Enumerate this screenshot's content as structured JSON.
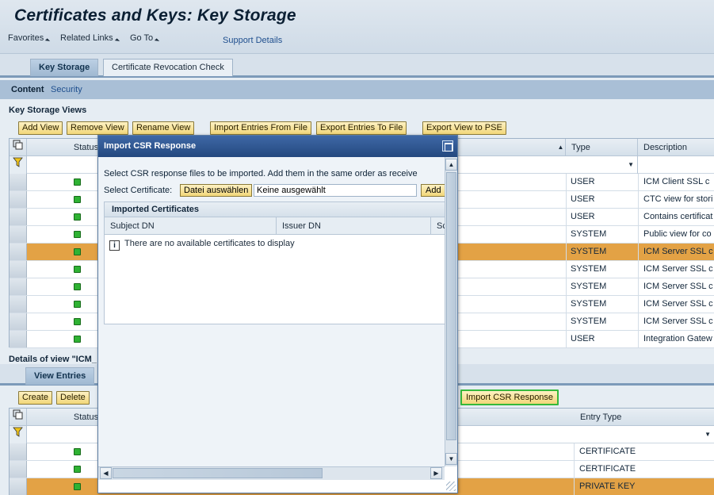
{
  "page": {
    "title": "Certificates and Keys: Key Storage",
    "menu": [
      "Favorites",
      "Related Links",
      "Go To"
    ],
    "support_link": "Support Details"
  },
  "tabs": [
    {
      "label": "Key Storage",
      "active": true
    },
    {
      "label": "Certificate Revocation Check",
      "active": false
    }
  ],
  "subnav": {
    "content": "Content",
    "security": "Security"
  },
  "key_storage_views": {
    "title": "Key Storage Views",
    "toolbar": [
      "Add View",
      "Remove View",
      "Rename View",
      "Import Entries From File",
      "Export Entries To File",
      "Export View to PSE"
    ],
    "columns": {
      "status": "Status",
      "type": "Type",
      "description": "Description"
    },
    "rows": [
      {
        "type": "USER",
        "description": "ICM Client SSL c",
        "selected": false
      },
      {
        "type": "USER",
        "description": "CTC view for stori",
        "selected": false
      },
      {
        "type": "USER",
        "description": "Contains certificat",
        "selected": false
      },
      {
        "type": "SYSTEM",
        "description": "Public view for co",
        "selected": false
      },
      {
        "type": "SYSTEM",
        "description": "ICM Server SSL c",
        "selected": true
      },
      {
        "type": "SYSTEM",
        "description": "ICM Server SSL c",
        "selected": false
      },
      {
        "type": "SYSTEM",
        "description": "ICM Server SSL c",
        "selected": false
      },
      {
        "type": "SYSTEM",
        "description": "ICM Server SSL c",
        "selected": false
      },
      {
        "type": "SYSTEM",
        "description": "ICM Server SSL c",
        "selected": false
      },
      {
        "type": "USER",
        "description": "Integration Gatew",
        "selected": false
      }
    ]
  },
  "details": {
    "title": "Details of view \"ICM_",
    "tab": "View Entries",
    "toolbar": [
      "Create",
      "Delete",
      "Import CSR Response"
    ],
    "columns": {
      "status": "Status",
      "entry_type": "Entry Type"
    },
    "rows": [
      {
        "entry_type": "CERTIFICATE",
        "selected": false
      },
      {
        "entry_type": "CERTIFICATE",
        "selected": false
      },
      {
        "entry_type": "PRIVATE KEY",
        "selected": true
      }
    ]
  },
  "dialog": {
    "title": "Import CSR Response",
    "instruction": "Select CSR response files to be imported. Add them in the same order as receive",
    "select_label": "Select Certificate:",
    "file_button": "Datei auswählen",
    "file_name": "Keine ausgewählt",
    "add_button": "Add",
    "imported": {
      "title": "Imported Certificates",
      "columns": [
        "Subject DN",
        "Issuer DN",
        "Sc"
      ],
      "empty_message": "There are no available certificates to display"
    }
  }
}
